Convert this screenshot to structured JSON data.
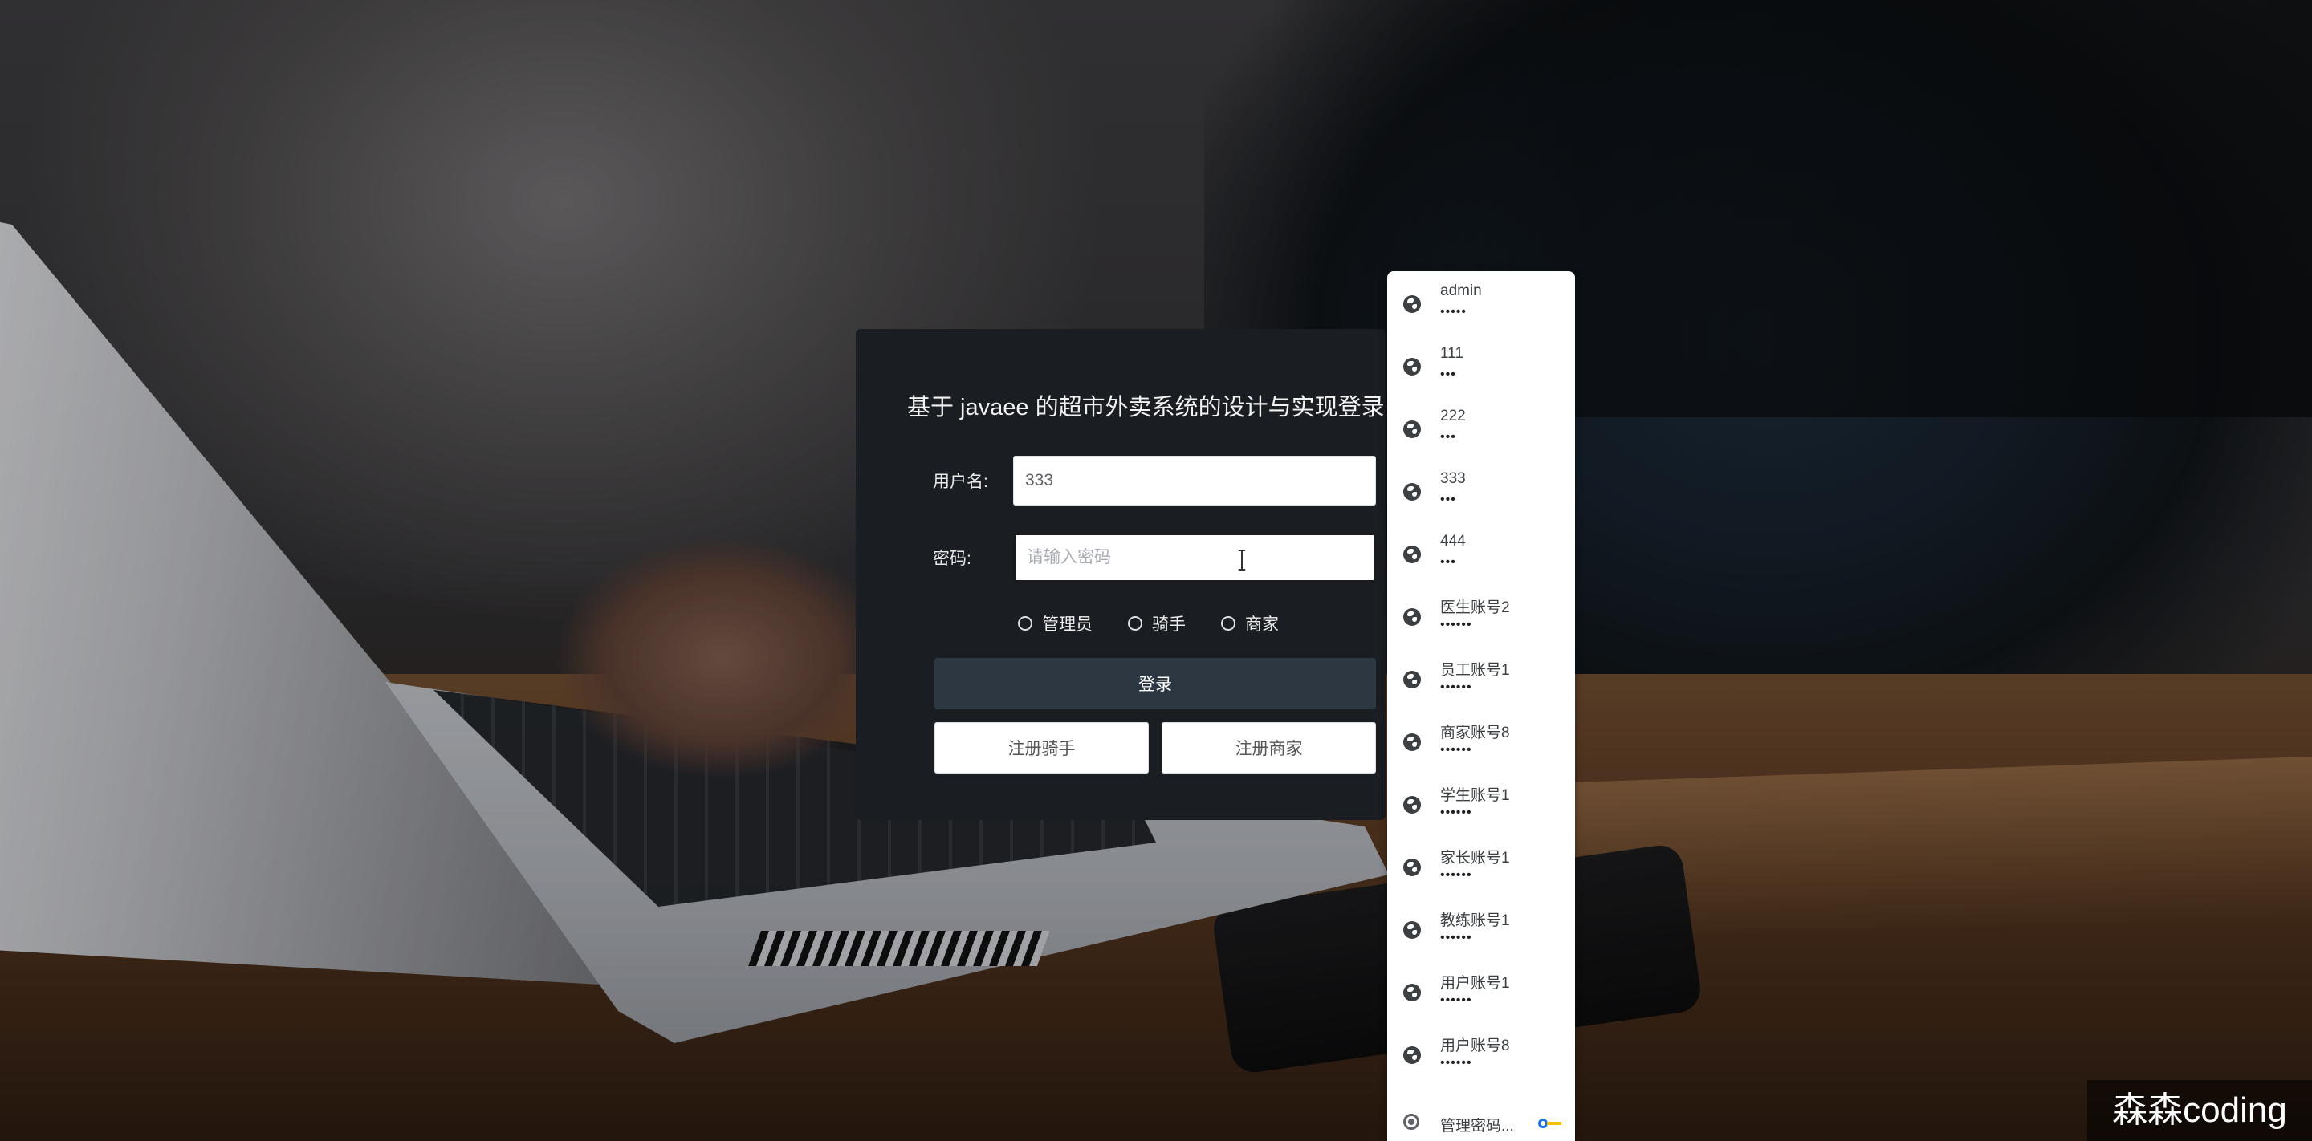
{
  "login": {
    "title": "基于 javaee 的超市外卖系统的设计与实现登录",
    "username_label": "用户名:",
    "username_value": "333",
    "password_label": "密码:",
    "password_placeholder": "请输入密码",
    "roles": [
      "管理员",
      "骑手",
      "商家"
    ],
    "login_button": "登录",
    "register_rider_button": "注册骑手",
    "register_merchant_button": "注册商家"
  },
  "autofill": {
    "items": [
      {
        "name": "admin",
        "mask": "•••••"
      },
      {
        "name": "111",
        "mask": "•••"
      },
      {
        "name": "222",
        "mask": "•••"
      },
      {
        "name": "333",
        "mask": "•••"
      },
      {
        "name": "444",
        "mask": "•••"
      },
      {
        "name": "医生账号2",
        "mask": "••••••"
      },
      {
        "name": "员工账号1",
        "mask": "••••••"
      },
      {
        "name": "商家账号8",
        "mask": "••••••"
      },
      {
        "name": "学生账号1",
        "mask": "••••••"
      },
      {
        "name": "家长账号1",
        "mask": "••••••"
      },
      {
        "name": "教练账号1",
        "mask": "••••••"
      },
      {
        "name": "用户账号1",
        "mask": "••••••"
      },
      {
        "name": "用户账号8",
        "mask": "••••••"
      }
    ],
    "manage_label": "管理密码..."
  },
  "watermark": "森森coding"
}
